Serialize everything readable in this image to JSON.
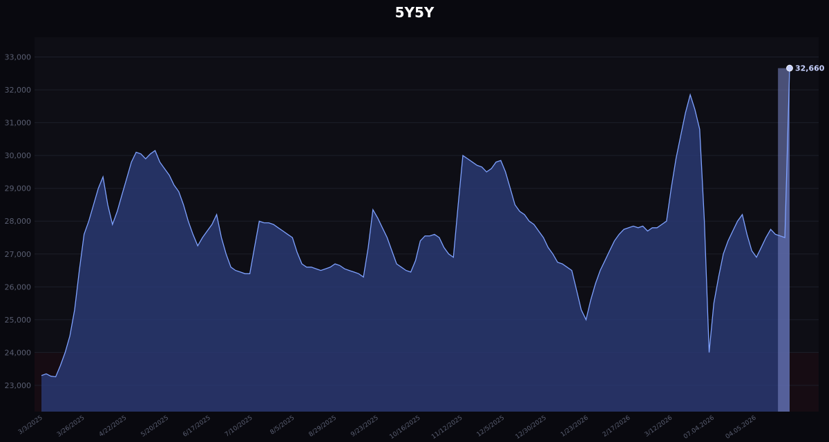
{
  "chart_data": {
    "type": "area",
    "title": "5Y5Y",
    "xlabel": "",
    "ylabel": "",
    "ylim": [
      22200,
      33600
    ],
    "y_ticks": [
      23000,
      24000,
      25000,
      26000,
      27000,
      28000,
      29000,
      30000,
      31000,
      32000,
      33000
    ],
    "y_tick_labels": [
      "23,000",
      "24,000",
      "25,000",
      "26,000",
      "27,000",
      "28,000",
      "29,000",
      "30,000",
      "31,000",
      "32,000",
      "33,000"
    ],
    "x_tick_labels": [
      "3/3/2025",
      "3/26/2025",
      "4/22/2025",
      "5/20/2025",
      "6/17/2025",
      "7/10/2025",
      "8/5/2025",
      "8/29/2025",
      "9/23/2025",
      "10/16/2025",
      "11/12/2025",
      "12/5/2025",
      "12/30/2025",
      "1/23/2026",
      "2/17/2026",
      "3/12/2026",
      "07.04.2026",
      "04.05.2026"
    ],
    "grid": true,
    "last_value_label": "32,660",
    "series": [
      {
        "values": [
          23300,
          23350,
          23280,
          23260,
          23600,
          24000,
          24500,
          25300,
          26500,
          27600,
          28000,
          28500,
          29000,
          29350,
          28500,
          27900,
          28300,
          28800,
          29300,
          29800,
          30100,
          30050,
          29900,
          30050,
          30150,
          29800,
          29600,
          29400,
          29100,
          28900,
          28500,
          28000,
          27600,
          27250,
          27500,
          27700,
          27900,
          28200,
          27500,
          27000,
          26600,
          26500,
          26450,
          26400,
          26400,
          27200,
          28000,
          27950,
          27950,
          27900,
          27800,
          27700,
          27600,
          27500,
          27050,
          26700,
          26600,
          26600,
          26550,
          26500,
          26550,
          26600,
          26700,
          26650,
          26550,
          26500,
          26450,
          26400,
          26300,
          27200,
          28350,
          28100,
          27800,
          27500,
          27100,
          26700,
          26600,
          26500,
          26450,
          26800,
          27400,
          27550,
          27550,
          27600,
          27500,
          27200,
          27000,
          26900,
          28500,
          30000,
          29900,
          29800,
          29700,
          29650,
          29500,
          29600,
          29800,
          29850,
          29500,
          29000,
          28500,
          28300,
          28200,
          28000,
          27900,
          27700,
          27500,
          27200,
          27000,
          26750,
          26700,
          26600,
          26500,
          25900,
          25300,
          25000,
          25600,
          26100,
          26500,
          26800,
          27100,
          27400,
          27600,
          27750,
          27800,
          27850,
          27800,
          27850,
          27700,
          27800,
          27800,
          27900,
          28000,
          29000,
          29900,
          30600,
          31300,
          31850,
          31400,
          30800,
          28000,
          24000,
          25500,
          26300,
          27000,
          27400,
          27700,
          28000,
          28200,
          27600,
          27100,
          26900,
          27200,
          27500,
          27750,
          27600,
          27550,
          27500,
          32660
        ]
      }
    ]
  },
  "style": {
    "line_color": "#7fa2ff",
    "fill_color": "#2b3c7a",
    "last_point_color": "#c8d2ff",
    "highlight_band_color": "#7b86c8",
    "lower_zone_color": "#1a0c12",
    "plot_bg": "#0e0e15",
    "grid_color": "#1c1e2a"
  }
}
